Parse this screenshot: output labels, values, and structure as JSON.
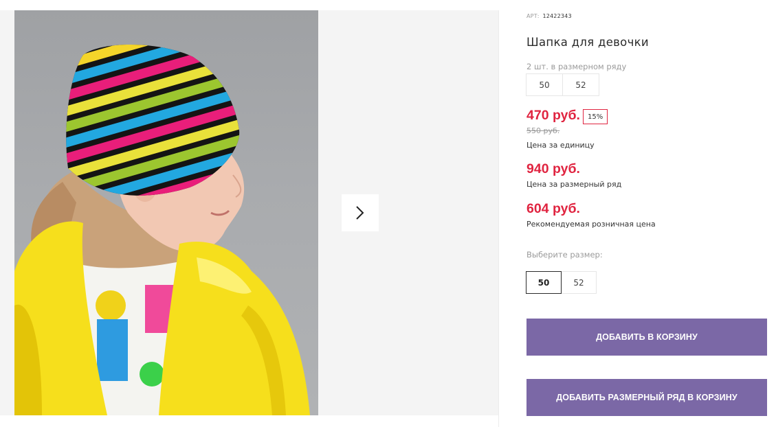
{
  "product": {
    "art_label": "АРТ:",
    "art_number": "12422343",
    "title": "Шапка для девочки",
    "series_label": "2 шт. в размерном ряду",
    "series_sizes": [
      "50",
      "52"
    ],
    "price_unit": "470 руб.",
    "discount": "15%",
    "old_price": "550 руб.",
    "price_unit_caption": "Цена за единицу",
    "price_series": "940 руб.",
    "price_series_caption": "Цена за размерный ряд",
    "price_retail": "604 руб.",
    "price_retail_caption": "Рекомендуемая розничная цена",
    "choose_size_label": "Выберите размер:",
    "size_options": [
      "50",
      "52"
    ],
    "selected_size": "50",
    "add_to_cart": "ДОБАВИТЬ В КОРЗИНУ",
    "add_series_to_cart": "ДОБАВИТЬ РАЗМЕРНЫЙ РЯД В КОРЗИНУ"
  },
  "gallery": {
    "next_icon": "chevron-right-icon"
  },
  "colors": {
    "price": "#e02440",
    "button": "#7b68a6",
    "discount_border": "#e02440"
  }
}
